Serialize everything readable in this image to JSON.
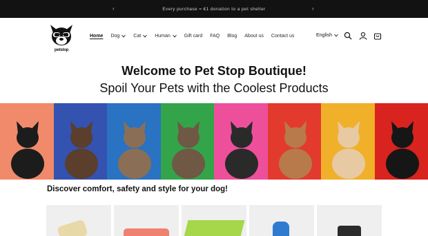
{
  "announcement": {
    "text": "Every purchase = €1 donation to a pet shelter"
  },
  "brand": {
    "logo_text": "petstop"
  },
  "nav": {
    "items": [
      {
        "label": "Home",
        "active": true,
        "dropdown": false
      },
      {
        "label": "Dog",
        "active": false,
        "dropdown": true
      },
      {
        "label": "Cat",
        "active": false,
        "dropdown": true
      },
      {
        "label": "Human",
        "active": false,
        "dropdown": true
      },
      {
        "label": "Gift card",
        "active": false,
        "dropdown": false
      },
      {
        "label": "FAQ",
        "active": false,
        "dropdown": false
      },
      {
        "label": "Blog",
        "active": false,
        "dropdown": false
      },
      {
        "label": "About us",
        "active": false,
        "dropdown": false
      },
      {
        "label": "Contact us",
        "active": false,
        "dropdown": false
      }
    ]
  },
  "header": {
    "language": "English",
    "icons": [
      "search-icon",
      "account-icon",
      "cart-icon"
    ]
  },
  "hero": {
    "title": "Welcome to Pet Stop Boutique!",
    "subtitle": "Spoil Your Pets with the Coolest Products"
  },
  "banner": {
    "panels": [
      {
        "bg": "#f08a6a",
        "dog": "#1c1c1c"
      },
      {
        "bg": "#3452b0",
        "dog": "#5b3e2b"
      },
      {
        "bg": "#2a72c2",
        "dog": "#8a6f56"
      },
      {
        "bg": "#33a44a",
        "dog": "#6f5844"
      },
      {
        "bg": "#ee4f9a",
        "dog": "#2a2a2a"
      },
      {
        "bg": "#e23b2e",
        "dog": "#b87a4b"
      },
      {
        "bg": "#f1b02a",
        "dog": "#e7c9a2"
      },
      {
        "bg": "#d8231f",
        "dog": "#161616"
      }
    ]
  },
  "section": {
    "heading": "Discover comfort, safety and style for your dog!"
  },
  "products": [
    {
      "name": "product-1",
      "accent": "#e8d9a8"
    },
    {
      "name": "product-2",
      "accent": "#f08070"
    },
    {
      "name": "product-3",
      "accent": "#a6d64a"
    },
    {
      "name": "product-4",
      "accent": "#2f7bd0"
    },
    {
      "name": "product-5",
      "accent": "#2b2b2b"
    }
  ]
}
